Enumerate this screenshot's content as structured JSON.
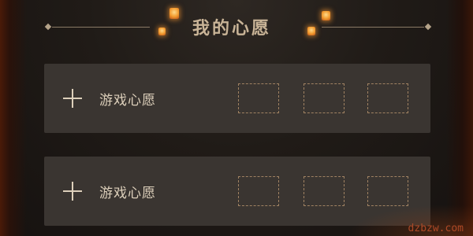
{
  "header": {
    "title": "我的心愿"
  },
  "wishes": [
    {
      "label": "游戏心愿",
      "add_icon": "plus-icon",
      "slots": 3
    },
    {
      "label": "游戏心愿",
      "add_icon": "plus-icon",
      "slots": 3
    }
  ],
  "watermark": "dzbzw.com",
  "colors": {
    "title": "#c9b497",
    "card": "#3a3531",
    "text": "#ddd0bb",
    "slot_border": "#a08262",
    "lantern": "#f29a2e"
  }
}
